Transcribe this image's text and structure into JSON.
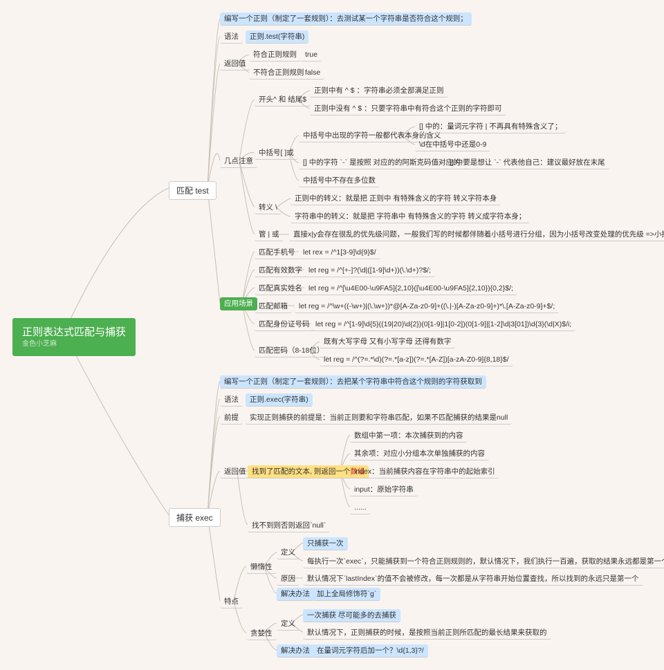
{
  "root": {
    "title": "正则表达式匹配与捕获",
    "author": "金色小芝麻"
  },
  "p": {
    "a": "匹配 test",
    "b": "捕获 exec",
    "a_def": "编写一个正则（制定了一套规则）：去测试某一个字符串是否符合这个规则；",
    "a_syntax": "语法",
    "a_syntax_v": "正则.test(字符串)",
    "a_return": "返回值",
    "a_r1": "符合正则规则",
    "a_r1v": "true",
    "a_r2": "不符合正则规则",
    "a_r2v": "false",
    "a_notes": "几点注意",
    "n1": "开头^ 和 结尾$",
    "n1a": "正则中有 ^ $ ：字符串必须全部满足正则",
    "n1b": "正则中没有 ^ $ ：只要字符串中有符合这个正则的字符即可",
    "n2": "中括号[ ]或",
    "n2a": "中括号中出现的字符一般都代表本身的含义",
    "n2a1": "[] 中的：量词元字符 | 不再具有特殊含义了；",
    "n2a2": "\\d在中括号中还是0-9",
    "n2b": "[] 中的字符 `-` 是按照 对应的的阿斯克码值对应的;",
    "n2b1": "[] 中要是想让 `-` 代表他自己：建议最好放在末尾",
    "n2c": "中括号中不存在多位数",
    "n3": "转义 \\",
    "n3a": "正则中的转义：就是把 正则中 有特殊含义的字符 转义字符本身",
    "n3b": "字符串中的转义：就是把 字符串中 有特殊含义的字符 转义成字符本身；",
    "n4": "管 | 或",
    "n4a": "直接x|y会存在很乱的优先级问题，一般我们写的时候都伴随着小括号进行分组，因为小括号改变处理的优先级 =>小括号：分组",
    "a_use": "应用场景",
    "u1": "匹配手机号",
    "u1v": "let rex = /^1[3-9]\\d{9}$/",
    "u2": "匹配有效数字",
    "u2v": "let reg = /^[+-]?(\\d|([1-9]\\d+))(\\.\\d+)?$/;",
    "u3": "匹配真实姓名",
    "u3v": "let reg = /^[\\u4E00-\\u9FA5]{2,10}([\\u4E00-\\u9FA5]{2,10}){0,2}$/;",
    "u4": "匹配邮箱",
    "u4v": "let reg = /^\\w+((-\\w+)|(\\.\\w+))*@[A-Za-z0-9]+((\\.|-)[A-Za-z0-9]+)*\\.[A-Za-z0-9]+$/;",
    "u5": "匹配身份证号码",
    "u5v": "let reg = /^[1-9]\\d{5}((19|20)\\d{2})(0[1-9]|1[0-2])(0[1-9]|[1-2]\\d|3[01])\\d{3}(\\d|X)$/i;",
    "u6": "匹配密码（8-18位）",
    "u6a": "既有大写字母 又有小写字母 还得有数字",
    "u6b": "let reg = /^(?=.*\\d)(?=.*[a-z])(?=.*[A-Z])[a-zA-Z0-9]{8,18}$/",
    "b_def": "编写一个正则（制定了一套规则）：去把某个字符串中符合这个规则的字符获取到",
    "b_syntax": "语法",
    "b_syntax_v": "正则.exec(字符串)",
    "b_pre": "前提",
    "b_pre_v": "实现正则捕获的前提是：当前正则要和字符串匹配，如果不匹配捕获的结果是null",
    "b_return": "返回值",
    "b_ret1_a": "找到了匹配的文本, 则返回一个",
    "b_ret1_b": "数组",
    "b_ret1_1": "数组中第一项：本次捕获到的内容",
    "b_ret1_2": "其余项：对应小分组本次单独捕获的内容",
    "b_ret1_3": "index：当前捕获内容在字符串中的起始索引",
    "b_ret1_4": "input：原始字符串",
    "b_ret1_5": "......",
    "b_ret2": "找不到则否则返回`null`",
    "b_feat": "特点",
    "f1": "懒惰性",
    "f1a": "定义",
    "f1a1": "只捕获一次",
    "f1a2": "每执行一次`exec`，只能捕获到一个符合正则规则的，默认情况下，我们执行一百遍，获取的结果永远都是第一个匹配到的，其余的捕获不到",
    "f1b": "原因",
    "f1b1": "默认情况下`lastIndex`的值不会被修改，每一次都是从字符串开始位置查找，所以找到的永远只是第一个",
    "f1c": "解决办法",
    "f1c1": "加上全局修饰符`g`",
    "f2": "贪婪性",
    "f2a": "定义",
    "f2a1": "一次捕获 尽可能多的去捕获",
    "f2a2": "默认情况下，正则捕获的时候，是按照当前正则所匹配的最长结果来获取的",
    "f2b": "解决办法",
    "f2b1": "在量词元字符后加一个？\\d{1,3}?/"
  }
}
